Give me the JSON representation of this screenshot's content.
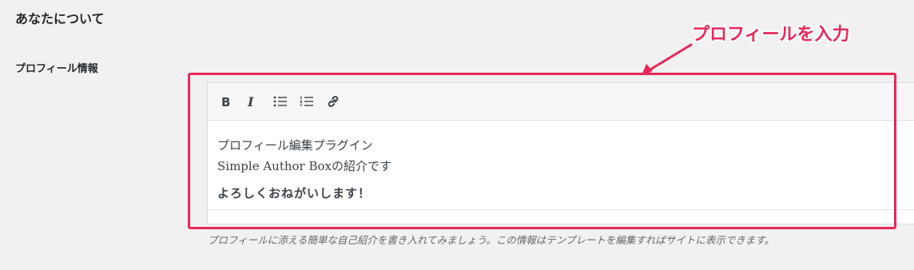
{
  "section": {
    "title": "あなたについて"
  },
  "profile_field": {
    "label": "プロフィール情報",
    "content": {
      "line1": "プロフィール編集プラグイン",
      "line2": "Simple Author Boxの紹介です",
      "line3": "よろしくおねがいします！"
    },
    "description": "プロフィールに添える簡単な自己紹介を書き入れてみましょう。この情報はテンプレートを編集すればサイトに表示できます。"
  },
  "toolbar": {
    "buttons": [
      {
        "name": "bold",
        "icon": "bold-icon"
      },
      {
        "name": "italic",
        "icon": "italic-icon"
      },
      {
        "name": "bulleted-list",
        "icon": "bulleted-list-icon"
      },
      {
        "name": "numbered-list",
        "icon": "numbered-list-icon"
      },
      {
        "name": "link",
        "icon": "link-icon"
      }
    ]
  },
  "annotation": {
    "text": "プロフィールを入力",
    "color": "#e8285a"
  }
}
